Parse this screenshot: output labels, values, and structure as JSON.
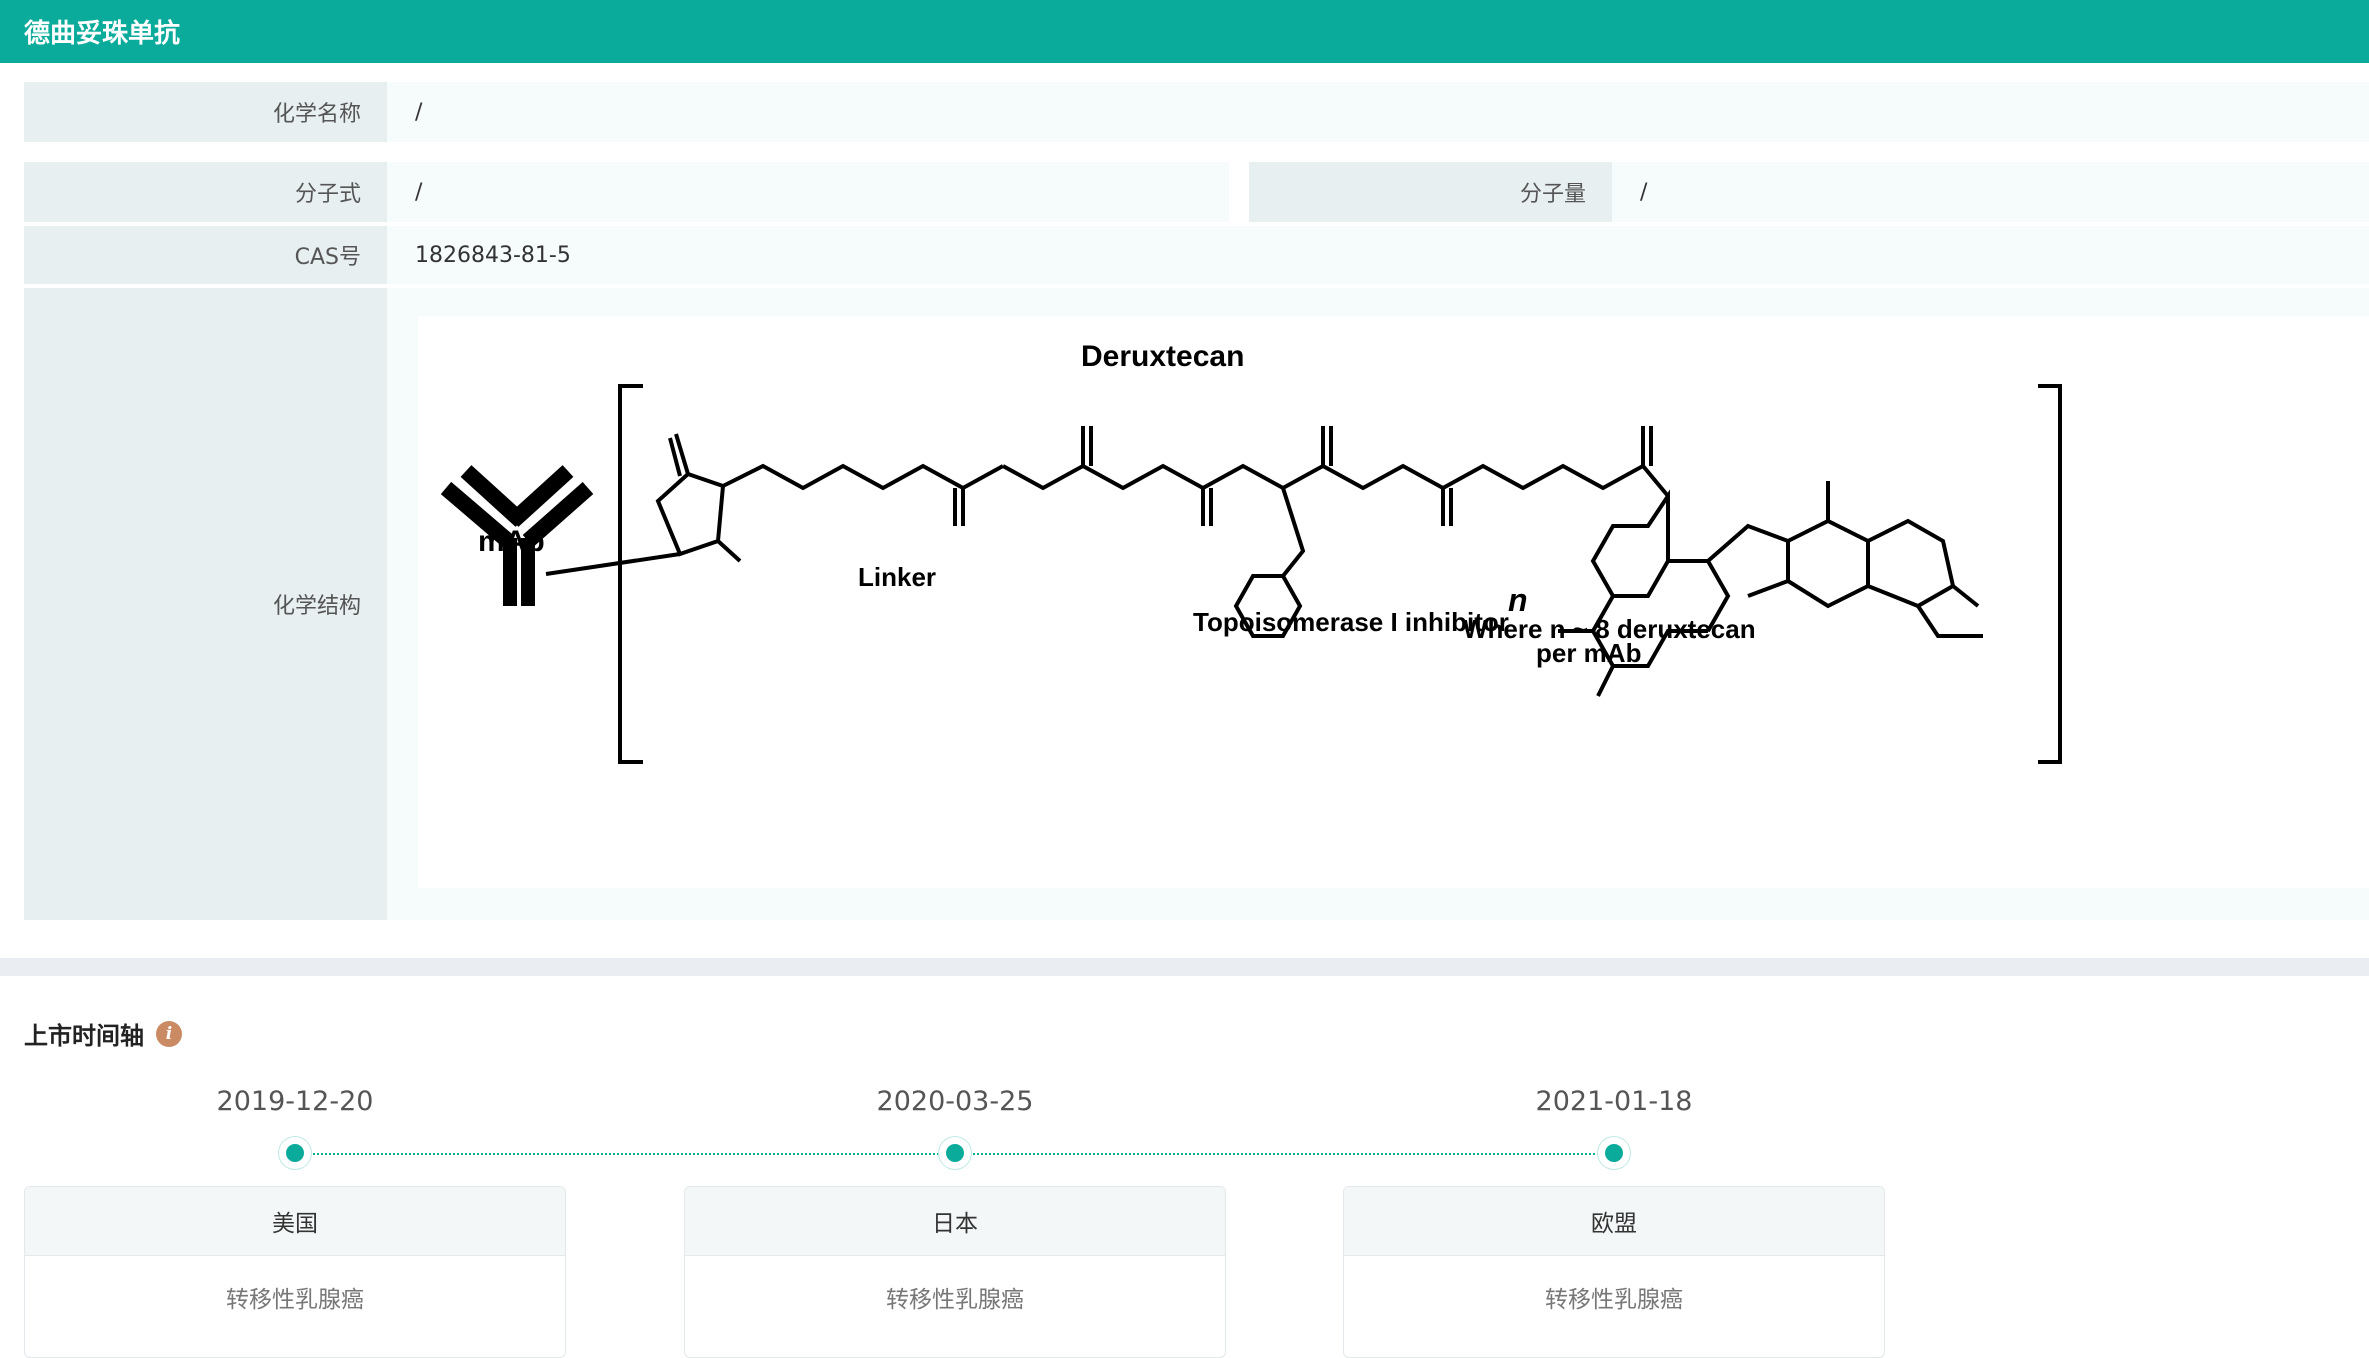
{
  "title": "德曲妥珠单抗",
  "info": {
    "chem_name_label": "化学名称",
    "chem_name_value": "/",
    "formula_label": "分子式",
    "formula_value": "/",
    "mw_label": "分子量",
    "mw_value": "/",
    "cas_label": "CAS号",
    "cas_value": "1826843-81-5",
    "structure_label": "化学结构"
  },
  "structure": {
    "title": "Deruxtecan",
    "mab": "mAb",
    "linker": "Linker",
    "inhibitor": "Topoisomerase I inhibitor",
    "n": "n",
    "note_line1": "Where n ~ 8 deruxtecan",
    "note_line2": "per mAb"
  },
  "timeline": {
    "heading": "上市时间轴",
    "info_icon": "info-icon",
    "items": [
      {
        "date": "2019-12-20",
        "country": "美国",
        "indication": "转移性乳腺癌"
      },
      {
        "date": "2020-03-25",
        "country": "日本",
        "indication": "转移性乳腺癌"
      },
      {
        "date": "2021-01-18",
        "country": "欧盟",
        "indication": "转移性乳腺癌"
      }
    ]
  },
  "colors": {
    "accent": "#0aab9b",
    "label_bg": "#e8eff1",
    "value_bg": "#f6fbfb"
  }
}
